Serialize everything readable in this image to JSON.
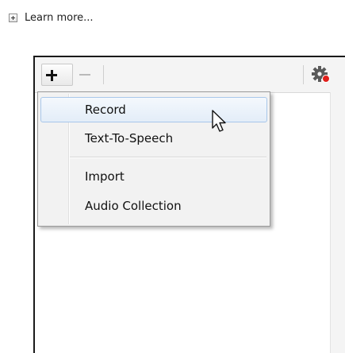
{
  "learn_more": {
    "label": "Learn more..."
  },
  "toolbar": {
    "add_icon": "plus-icon",
    "remove_icon": "minus-icon",
    "settings_icon": "gear-icon",
    "settings_badge_color": "#e0201b"
  },
  "menu": {
    "items": [
      {
        "label": "Record",
        "state": "hover"
      },
      {
        "label": "Text-To-Speech"
      },
      {
        "label": "Import"
      },
      {
        "label": "Audio Collection"
      }
    ]
  },
  "colors": {
    "menu_hover_border": "#a8c7ea",
    "menu_background": "#f2f2f2",
    "panel_border": "#1a1a1a"
  }
}
